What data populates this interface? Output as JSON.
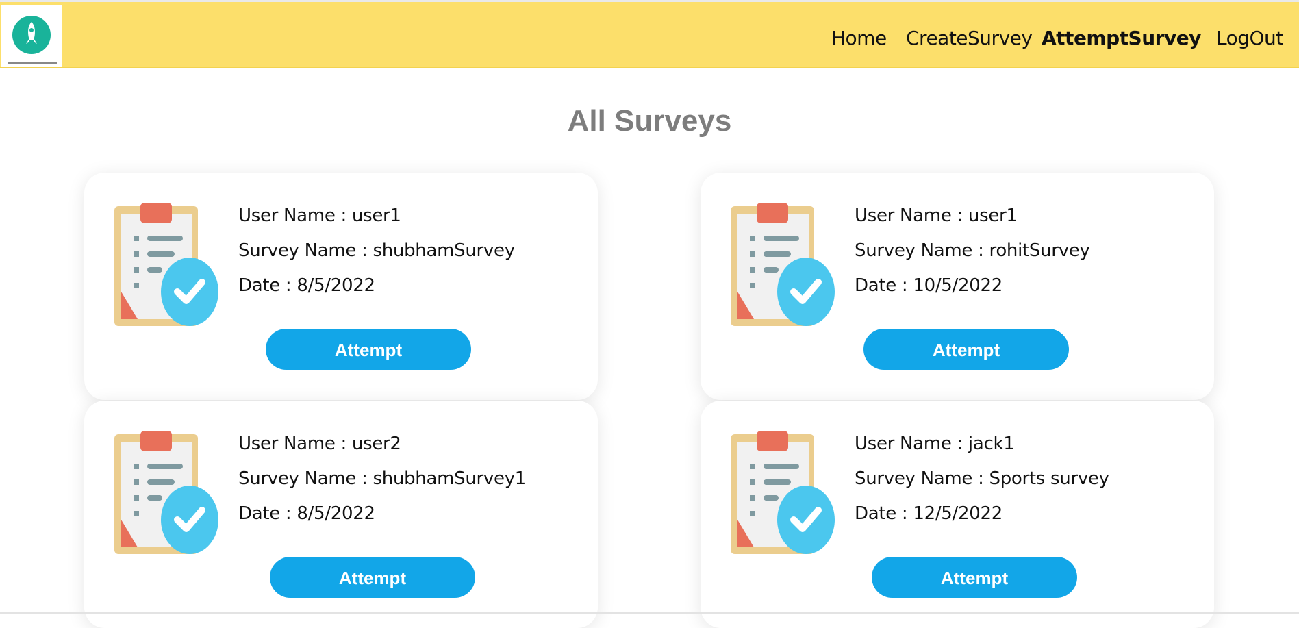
{
  "navbar": {
    "logo_icon": "rocket-logo-icon",
    "links": [
      {
        "label": "Home",
        "active": false
      },
      {
        "label": "CreateSurvey",
        "active": false
      },
      {
        "label": "AttemptSurvey",
        "active": true
      },
      {
        "label": "LogOut",
        "active": false
      }
    ],
    "background_color": "#fcdf6b"
  },
  "main": {
    "title": "All Surveys",
    "surveys": [
      {
        "user": "User Name : user1",
        "survey": "Survey Name : shubhamSurvey",
        "date": "Date : 8/5/2022",
        "button": "Attempt"
      },
      {
        "user": "User Name : user1",
        "survey": "Survey Name : rohitSurvey",
        "date": "Date : 10/5/2022",
        "button": "Attempt"
      },
      {
        "user": "User Name : user2",
        "survey": "Survey Name : shubhamSurvey1",
        "date": "Date : 8/5/2022",
        "button": "Attempt"
      },
      {
        "user": "User Name : jack1",
        "survey": "Survey Name : Sports survey",
        "date": "Date : 12/5/2022",
        "button": "Attempt"
      }
    ],
    "card_icon": "clipboard-check-icon",
    "button_color": "#12a6e8"
  }
}
